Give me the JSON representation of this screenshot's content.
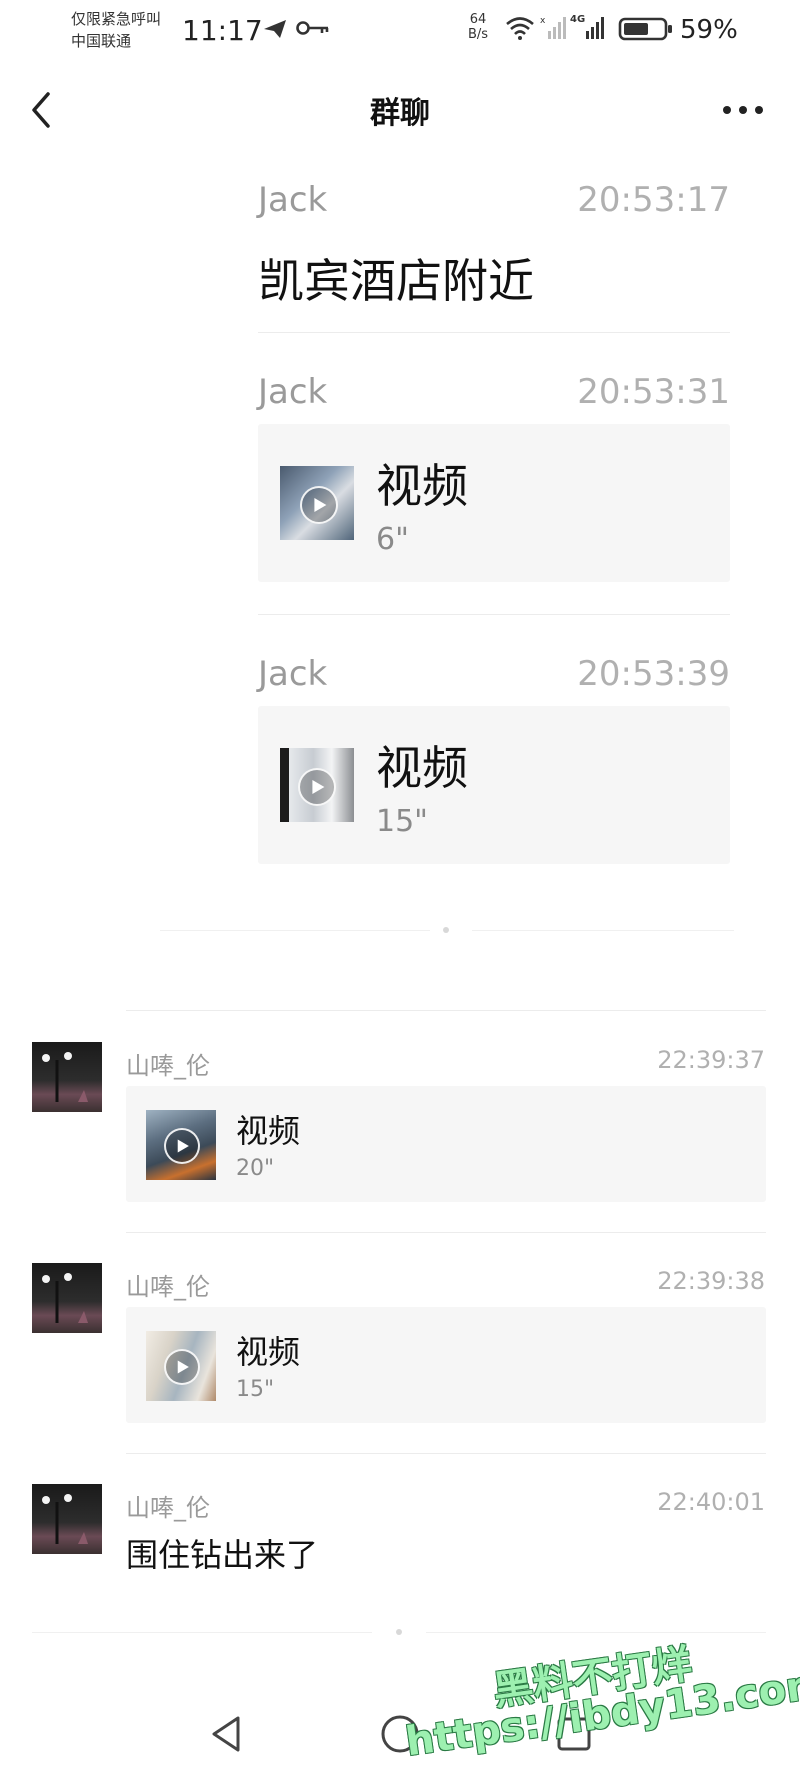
{
  "status_bar": {
    "carrier_line1": "仅限紧急呼叫",
    "carrier_line2": "中国联通",
    "time": "11:17",
    "net_speed_value": "64",
    "net_speed_unit": "B/s",
    "signal_label": "4G",
    "battery_percent": "59%"
  },
  "nav": {
    "title": "群聊"
  },
  "forwarded_messages": [
    {
      "name": "Jack",
      "time": "20:53:17",
      "text": "凯宾酒店附近"
    },
    {
      "name": "Jack",
      "time": "20:53:31",
      "video_title": "视频",
      "duration": "6\""
    },
    {
      "name": "Jack",
      "time": "20:53:39",
      "video_title": "视频",
      "duration": "15\""
    }
  ],
  "group_messages": [
    {
      "name": "山唪_伦",
      "time": "22:39:37",
      "video_title": "视频",
      "duration": "20\""
    },
    {
      "name": "山唪_伦",
      "time": "22:39:38",
      "video_title": "视频",
      "duration": "15\""
    },
    {
      "name": "山唪_伦",
      "time": "22:40:01",
      "text": "围住钻出来了"
    }
  ],
  "watermark": {
    "line1": "黑料不打烊",
    "line2": "https://ibdy13.com"
  },
  "icons": {
    "back": "chevron-left-icon",
    "more": "more-dots-icon",
    "play": "play-icon",
    "nav_back": "triangle-back-icon",
    "nav_home": "circle-home-icon",
    "nav_recent": "square-recent-icon"
  }
}
